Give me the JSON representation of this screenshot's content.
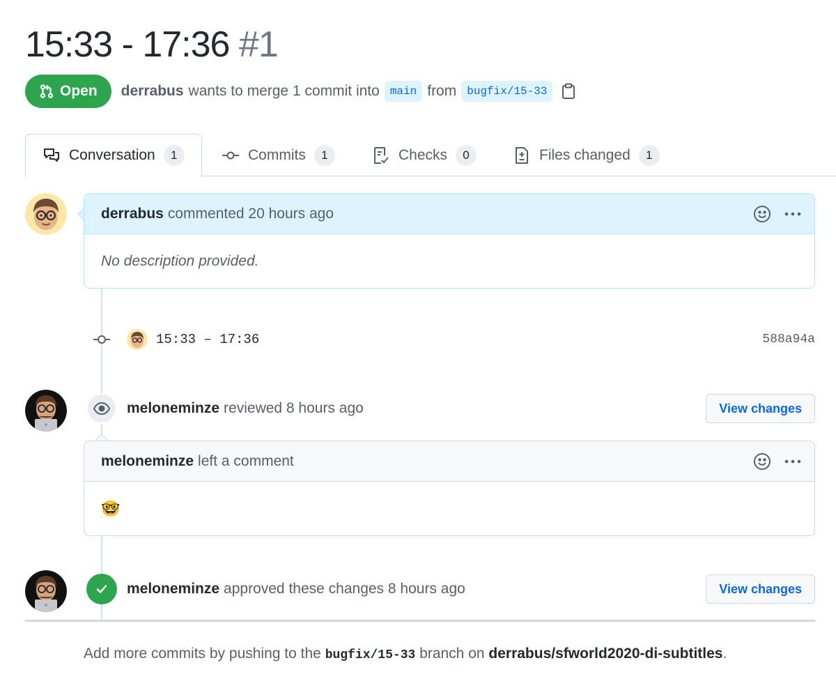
{
  "pr": {
    "title": "15:33 - 17:36",
    "number": "#1",
    "state": "Open",
    "author": "derrabus",
    "merge_text": "wants to merge 1 commit into",
    "base_branch": "main",
    "from_text": "from",
    "head_branch": "bugfix/15-33"
  },
  "tabs": [
    {
      "label": "Conversation",
      "count": "1",
      "icon": "conversation-icon"
    },
    {
      "label": "Commits",
      "count": "1",
      "icon": "commit-icon"
    },
    {
      "label": "Checks",
      "count": "0",
      "icon": "checklist-icon"
    },
    {
      "label": "Files changed",
      "count": "1",
      "icon": "file-diff-icon"
    }
  ],
  "comment1": {
    "author": "derrabus",
    "action": "commented 20 hours ago",
    "body": "No description provided."
  },
  "commit": {
    "message": "15:33 – 17:36",
    "sha": "588a94a"
  },
  "review": {
    "author": "meloneminze",
    "action": "reviewed 8 hours ago",
    "button": "View changes",
    "comment_author": "meloneminze",
    "comment_action": "left a comment",
    "comment_body": "🤓"
  },
  "approval": {
    "author": "meloneminze",
    "action": "approved these changes 8 hours ago",
    "button": "View changes"
  },
  "footer": {
    "prefix": "Add more commits by pushing to the",
    "branch": "bugfix/15-33",
    "middle": "branch on",
    "repo": "derrabus/sfworld2020-di-subtitles",
    "suffix": "."
  },
  "colors": {
    "open_green": "#2da44e",
    "link_blue": "#0969da",
    "header_blue": "#ddf4ff"
  }
}
